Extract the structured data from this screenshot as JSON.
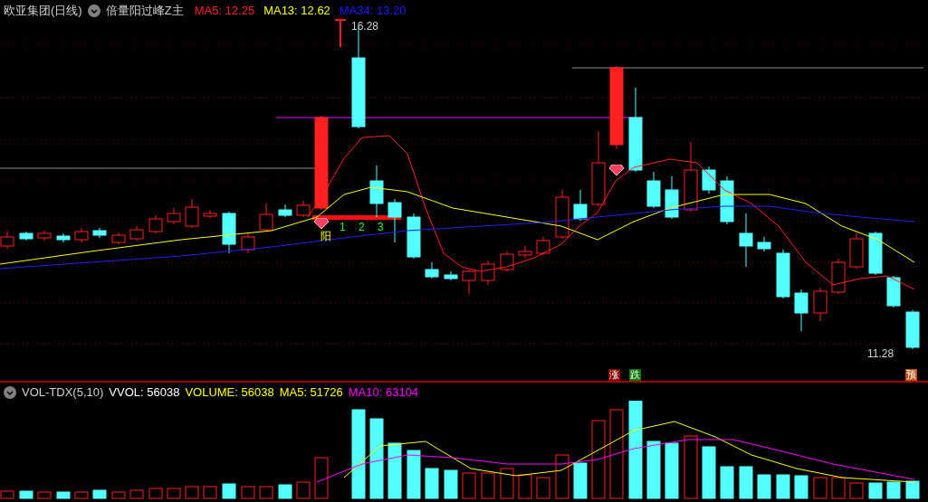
{
  "header": {
    "name": "欧亚集团(日线)",
    "indicator": "倍量阳过峰Z主",
    "ma": [
      {
        "label": "MA5: 12.25",
        "color": "#ff2020"
      },
      {
        "label": "MA13: 12.62",
        "color": "#ffff00"
      },
      {
        "label": "MA34: 13.20",
        "color": "#1a1aff"
      }
    ]
  },
  "chart_labels": {
    "high": "16.28",
    "low": "11.28",
    "count": [
      "1",
      "2",
      "3"
    ],
    "yang": "阳",
    "signals": [
      {
        "text": "涨",
        "color": "#8b0000"
      },
      {
        "text": "跌",
        "color": "#007a00"
      },
      {
        "text": "预",
        "color": "#c05010"
      }
    ]
  },
  "volume": {
    "name": "VOL-TDX(5,10)",
    "stats": [
      {
        "label": "VVOL: 56038",
        "color": "#ffffff"
      },
      {
        "label": "VOLUME: 56038",
        "color": "#ffff00"
      },
      {
        "label": "MA5: 51726",
        "color": "#ffff00"
      },
      {
        "label": "MA10: 63104",
        "color": "#ff00ff"
      }
    ]
  }
}
